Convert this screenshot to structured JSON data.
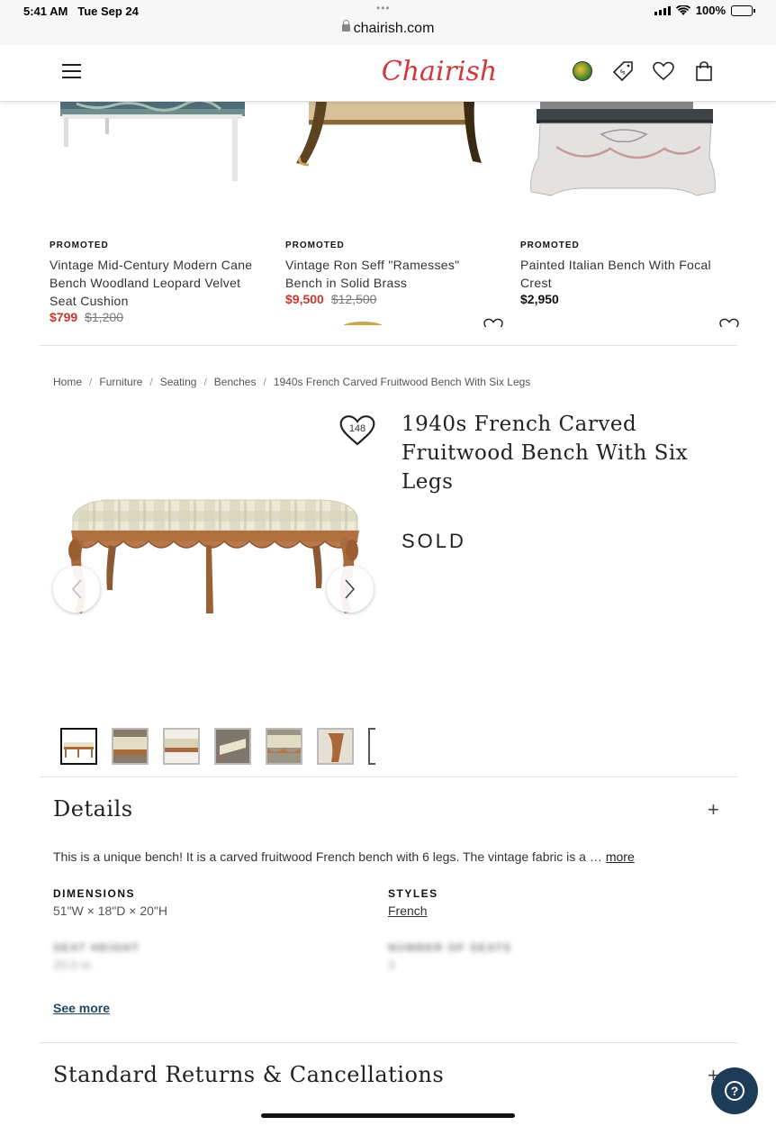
{
  "status_bar": {
    "time": "5:41 AM",
    "date": "Tue Sep 24",
    "dots": "•••",
    "url": "chairish.com",
    "battery": "100%"
  },
  "header": {
    "logo": "Chairish"
  },
  "promoted": [
    {
      "tag": "PROMOTED",
      "name": "Vintage Mid-Century Modern Cane Bench Woodland Leopard Velvet Seat Cushion",
      "price": "$799",
      "old_price": "$1,200"
    },
    {
      "tag": "PROMOTED",
      "name": "Vintage Ron Seff \"Ramesses\" Bench in Solid Brass",
      "price": "$9,500",
      "old_price": "$12,500"
    },
    {
      "tag": "PROMOTED",
      "name": "Painted Italian Bench With Focal Crest",
      "price": "$2,950",
      "old_price": ""
    }
  ],
  "breadcrumb": [
    "Home",
    "Furniture",
    "Seating",
    "Benches",
    "1940s French Carved Fruitwood Bench With Six Legs"
  ],
  "product": {
    "title": "1940s French Carved Fruitwood Bench With Six Legs",
    "status": "SOLD",
    "favorites": "148"
  },
  "details": {
    "title": "Details",
    "description": "This is a unique bench! It is a carved fruitwood French bench with 6 legs. The vintage fabric is a …",
    "more": "more",
    "dimensions_label": "DIMENSIONS",
    "dimensions_value": "51\"W × 18\"D × 20\"H",
    "styles_label": "STYLES",
    "styles_value": "French",
    "seat_height_label": "SEAT HEIGHT",
    "seat_height_value": "20.0 in",
    "seats_label": "NUMBER OF SEATS",
    "seats_value": "3",
    "see_more": "See more"
  },
  "returns": {
    "title": "Standard Returns & Cancellations"
  },
  "help": {
    "label": "?"
  }
}
